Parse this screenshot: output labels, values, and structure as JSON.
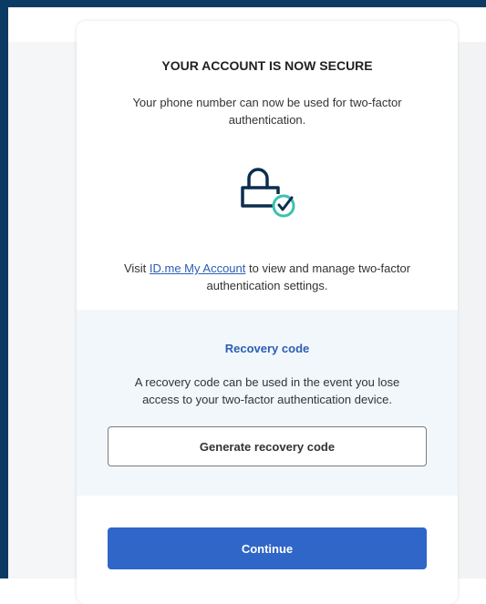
{
  "card": {
    "title": "YOUR ACCOUNT IS NOW SECURE",
    "description": "Your phone number can now be used for two-factor authentication.",
    "icon": "lock-check-icon",
    "visit_prefix": "Visit ",
    "visit_link": "ID.me My Account",
    "visit_suffix": " to view and manage two-factor authentication settings."
  },
  "recovery": {
    "title": "Recovery code",
    "description": "A recovery code can be used in the event you lose access to your two-factor authentication device.",
    "button_label": "Generate recovery code"
  },
  "footer": {
    "continue_label": "Continue"
  },
  "colors": {
    "accent": "#2f66c8",
    "link": "#2a5eb5",
    "frame": "#0b3b63",
    "check_ring": "#3ac2b0"
  }
}
